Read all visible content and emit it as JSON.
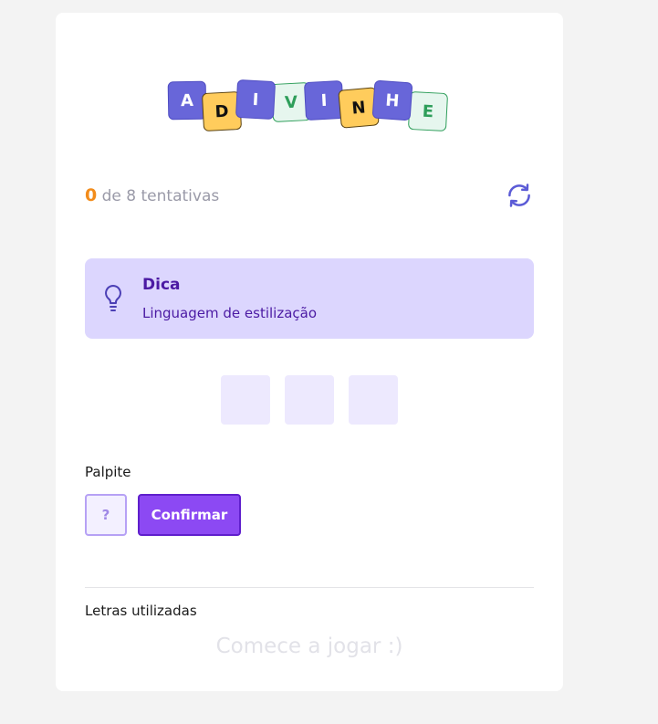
{
  "logo": {
    "tiles": [
      {
        "letter": "A",
        "color": "#6866d9"
      },
      {
        "letter": "D",
        "color": "#ffcc5c"
      },
      {
        "letter": "I",
        "color": "#6866d9"
      },
      {
        "letter": "V",
        "color": "#e6f6ee"
      },
      {
        "letter": "I",
        "color": "#6866d9"
      },
      {
        "letter": "N",
        "color": "#ffcc5c"
      },
      {
        "letter": "H",
        "color": "#6866d9"
      },
      {
        "letter": "E",
        "color": "#e6f6ee"
      }
    ]
  },
  "status": {
    "attempts_count": "0",
    "attempts_text": "de 8 tentativas",
    "refresh_icon": "refresh-icon"
  },
  "hint": {
    "icon": "lightbulb-icon",
    "title": "Dica",
    "text": "Linguagem de estilização"
  },
  "word": {
    "slots": [
      "",
      "",
      ""
    ]
  },
  "guess": {
    "label": "Palpite",
    "placeholder": "?",
    "value": "",
    "confirm_label": "Confirmar"
  },
  "used_letters": {
    "label": "Letras utilizadas",
    "empty_message": "Comece a jogar :)"
  },
  "colors": {
    "accent": "#8c49f3",
    "attempts_count": "#f28c1b",
    "hint_bg": "#dcd6fe",
    "page_bg": "#f3f3f3"
  }
}
